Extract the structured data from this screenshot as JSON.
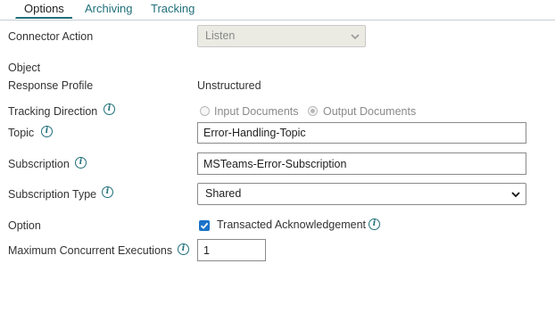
{
  "tabs": [
    {
      "label": "Options",
      "active": true
    },
    {
      "label": "Archiving",
      "active": false
    },
    {
      "label": "Tracking",
      "active": false
    }
  ],
  "accent_color": "#1f6f7a",
  "form": {
    "connector_action": {
      "label": "Connector Action",
      "value": "Listen",
      "disabled": true
    },
    "object": {
      "label": "Object"
    },
    "response_profile": {
      "label": "Response Profile",
      "value": "Unstructured"
    },
    "tracking_direction": {
      "label": "Tracking Direction",
      "options": [
        "Input Documents",
        "Output Documents"
      ],
      "selected": "Output Documents",
      "disabled": true
    },
    "topic": {
      "label": "Topic",
      "value": "Error-Handling-Topic"
    },
    "subscription": {
      "label": "Subscription",
      "value": "MSTeams-Error-Subscription"
    },
    "subscription_type": {
      "label": "Subscription Type",
      "value": "Shared"
    },
    "option": {
      "label": "Option",
      "checkbox_label": "Transacted Acknowledgement",
      "checked": true
    },
    "max_concurrent": {
      "label": "Maximum Concurrent Executions",
      "value": "1"
    }
  },
  "icons": {
    "info": "info-icon",
    "chevron": "chevron-down-icon",
    "check": "checkmark-icon"
  }
}
